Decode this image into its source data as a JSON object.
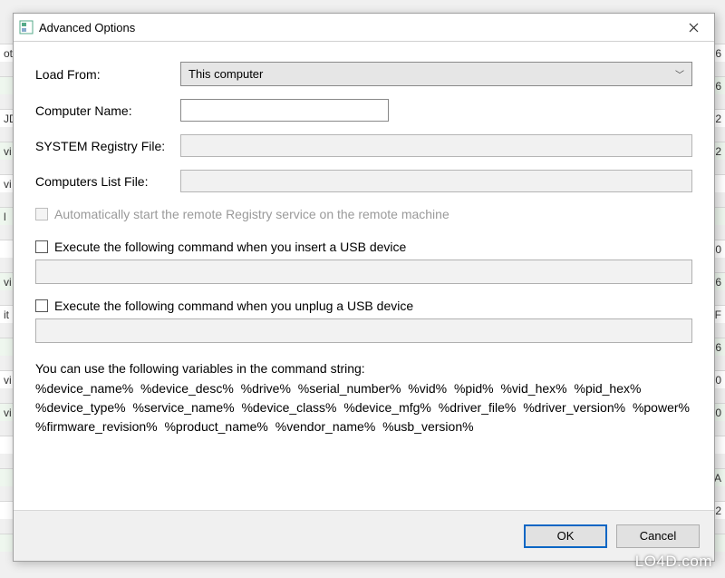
{
  "bg": {
    "leftcol_prefix": [
      "ot",
      "",
      "JD",
      "vi",
      "vi",
      "l",
      "",
      "vi",
      "it",
      "",
      "vi",
      "vi",
      "",
      "",
      "",
      ""
    ],
    "rightcol_suffix": [
      "6",
      "6",
      "2",
      "2",
      "",
      "",
      "0",
      "6",
      "F",
      "6",
      "0",
      "0",
      "",
      "A",
      "2",
      ""
    ]
  },
  "dialog": {
    "title": "Advanced Options"
  },
  "form": {
    "load_from_label": "Load From:",
    "load_from_value": "This computer",
    "computer_name_label": "Computer Name:",
    "computer_name_value": "",
    "system_registry_label": "SYSTEM Registry File:",
    "system_registry_value": "",
    "computers_list_label": "Computers List File:",
    "computers_list_value": ""
  },
  "checks": {
    "auto_start_registry": "Automatically start the remote Registry service on the remote machine",
    "exec_on_insert": "Execute the following command when you insert a USB device",
    "exec_on_unplug": "Execute the following command when you unplug a USB device"
  },
  "help": {
    "intro": "You can use the following variables in the command string:",
    "vars": "%device_name%  %device_desc%  %drive%  %serial_number%  %vid% %pid%  %vid_hex% %pid_hex%  %device_type%  %service_name%  %device_class% %device_mfg%  %driver_file% %driver_version%  %power%  %firmware_revision%  %product_name%  %vendor_name% %usb_version%"
  },
  "buttons": {
    "ok": "OK",
    "cancel": "Cancel"
  },
  "watermark": "LO4D.com"
}
